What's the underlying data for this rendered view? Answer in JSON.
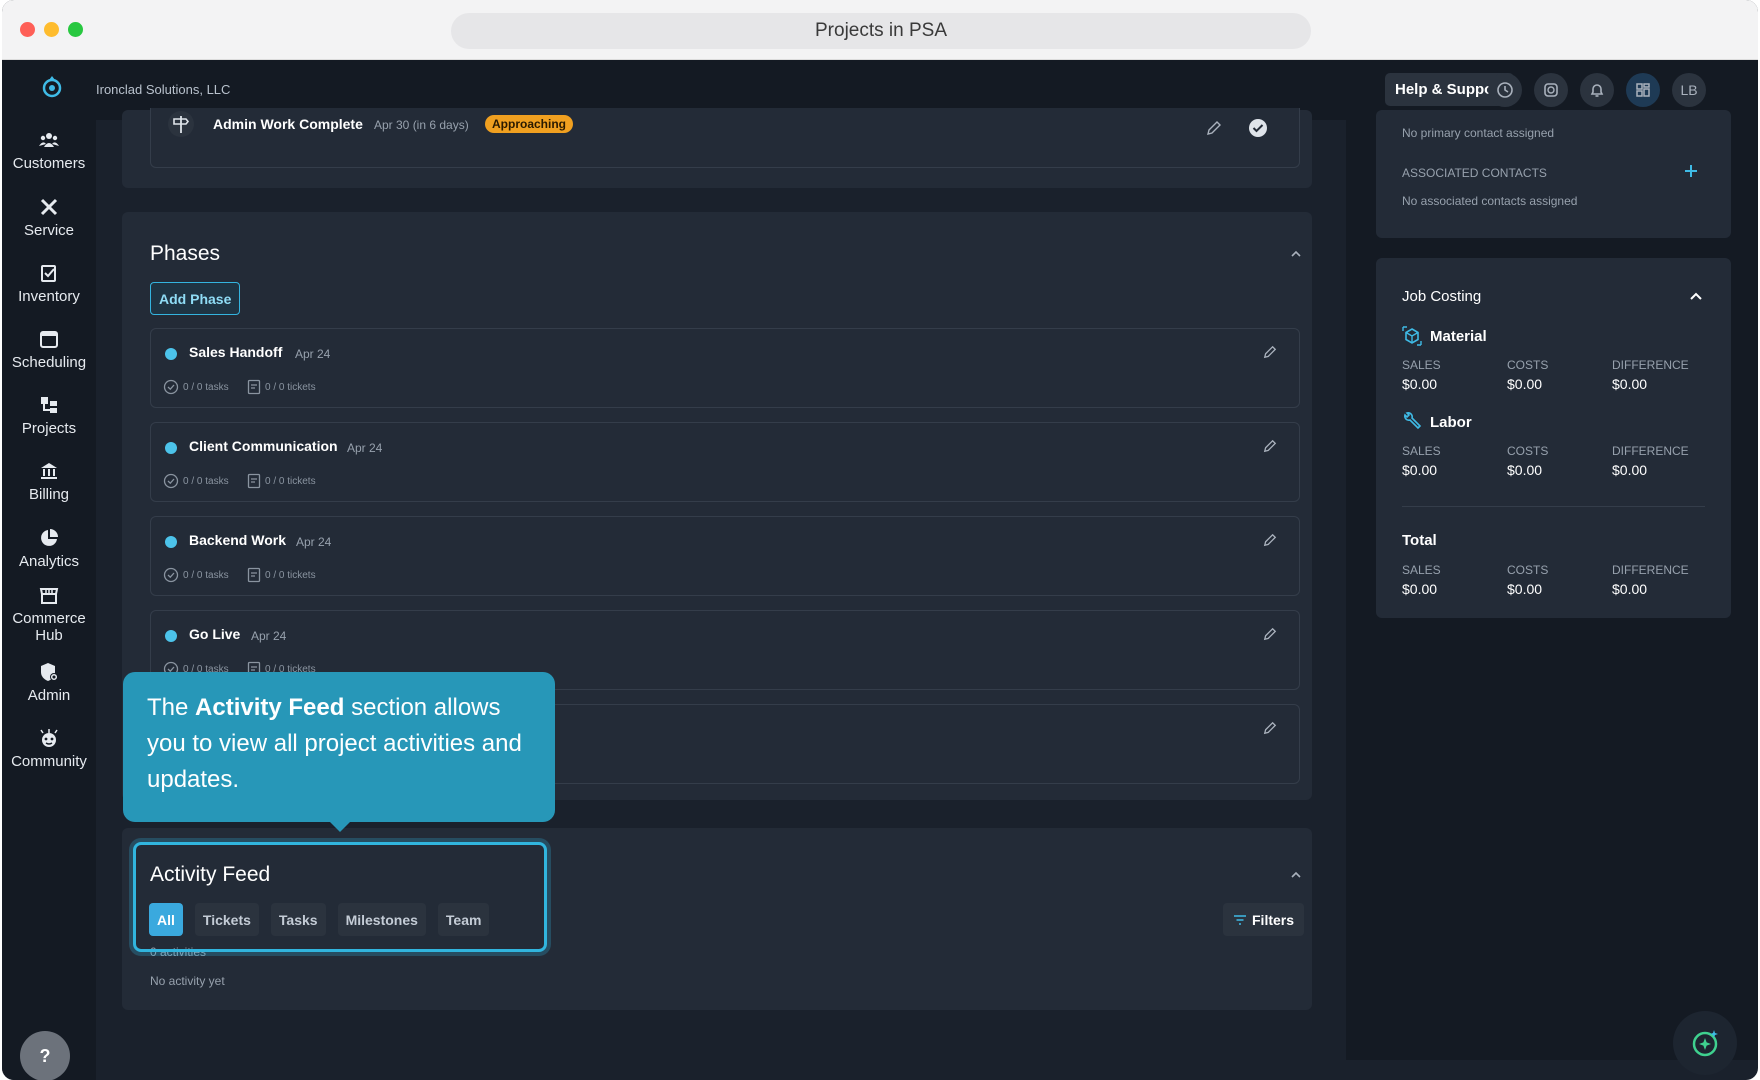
{
  "window": {
    "url_title": "Projects in PSA"
  },
  "header": {
    "company": "Ironclad Solutions, LLC",
    "help_label": "Help & Support",
    "avatar_initials": "LB"
  },
  "sidebar": {
    "items": [
      {
        "label": "Customers",
        "icon": "customers-icon"
      },
      {
        "label": "Service",
        "icon": "service-icon"
      },
      {
        "label": "Inventory",
        "icon": "inventory-icon"
      },
      {
        "label": "Scheduling",
        "icon": "scheduling-icon"
      },
      {
        "label": "Projects",
        "icon": "projects-icon"
      },
      {
        "label": "Billing",
        "icon": "billing-icon"
      },
      {
        "label": "Analytics",
        "icon": "analytics-icon"
      },
      {
        "label": "Commerce Hub",
        "icon": "commerce-hub-icon"
      },
      {
        "label": "Admin",
        "icon": "admin-icon"
      },
      {
        "label": "Community",
        "icon": "community-icon"
      }
    ],
    "help_glyph": "?"
  },
  "milestone": {
    "title": "Admin Work Complete",
    "date": "Apr 30 (in 6 days)",
    "badge": "Approaching"
  },
  "phases": {
    "title": "Phases",
    "add_label": "Add Phase",
    "items": [
      {
        "name": "Sales Handoff",
        "date": "Apr 24",
        "tasks": "0 / 0 tasks",
        "tickets": "0 / 0 tickets"
      },
      {
        "name": "Client Communication",
        "date": "Apr 24",
        "tasks": "0 / 0 tasks",
        "tickets": "0 / 0 tickets"
      },
      {
        "name": "Backend Work",
        "date": "Apr 24",
        "tasks": "0 / 0 tasks",
        "tickets": "0 / 0 tickets"
      },
      {
        "name": "Go Live",
        "date": "Apr 24",
        "tasks": "0 / 0 tasks",
        "tickets": "0 / 0 tickets"
      }
    ]
  },
  "activity": {
    "title": "Activity Feed",
    "tabs": [
      "All",
      "Tickets",
      "Tasks",
      "Milestones",
      "Team"
    ],
    "active_tab": "All",
    "filters_label": "Filters",
    "count": "0 activities",
    "empty": "No activity yet"
  },
  "tooltip": {
    "pre": "The ",
    "bold": "Activity Feed",
    "post": " section allows you to view all project activities and updates."
  },
  "contacts": {
    "primary_empty": "No primary contact assigned",
    "associated_label": "ASSOCIATED CONTACTS",
    "associated_empty": "No associated contacts assigned"
  },
  "job_costing": {
    "title": "Job Costing",
    "col_labels": [
      "SALES",
      "COSTS",
      "DIFFERENCE"
    ],
    "groups": [
      {
        "name": "Material",
        "values": [
          "$0.00",
          "$0.00",
          "$0.00"
        ]
      },
      {
        "name": "Labor",
        "values": [
          "$0.00",
          "$0.00",
          "$0.00"
        ]
      },
      {
        "name": "Total",
        "values": [
          "$0.00",
          "$0.00",
          "$0.00"
        ]
      }
    ]
  },
  "colors": {
    "accent": "#3aa9de",
    "badge": "#f0a020",
    "tooltip": "#2797b8",
    "background": "#1a212c"
  }
}
